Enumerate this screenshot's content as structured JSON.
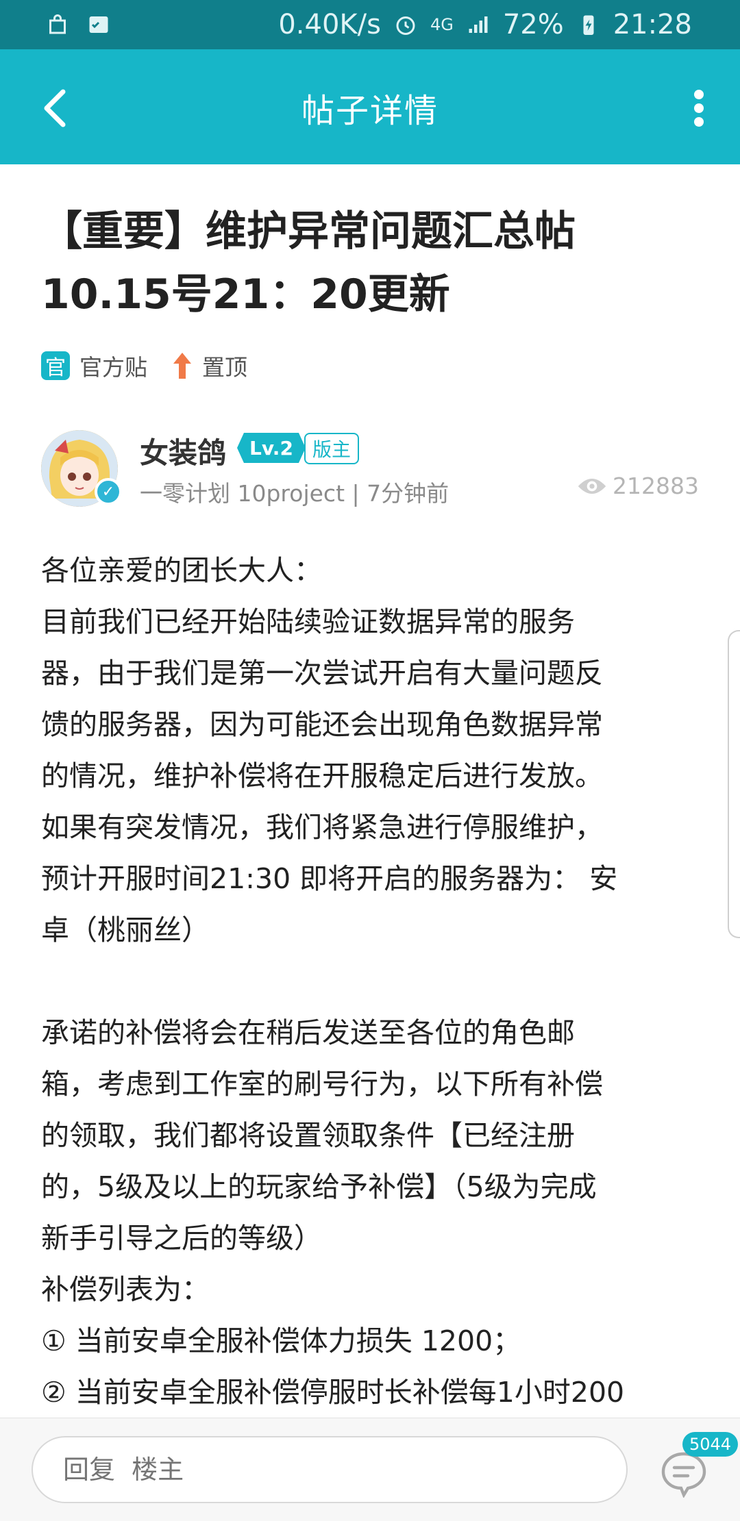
{
  "status_bar": {
    "speed": "0.40K/s",
    "network": "4G",
    "battery": "72%",
    "time": "21:28"
  },
  "header": {
    "title": "帖子详情",
    "back_icon": "back-arrow-icon",
    "more_icon": "more-vertical-icon"
  },
  "post": {
    "title_line1": "【重要】维护异常问题汇总帖",
    "title_line2": "10.15号21：20更新",
    "tags": [
      {
        "badge": "官",
        "label": "官方贴"
      },
      {
        "label": "置顶"
      }
    ]
  },
  "author": {
    "name": "女装鸽",
    "level": "Lv.2",
    "role": "版主",
    "meta": "一零计划 10project  |  7分钟前",
    "views": "212883"
  },
  "content": {
    "lines": [
      "各位亲爱的团长大人：",
      "目前我们已经开始陆续验证数据异常的服务",
      "器，由于我们是第一次尝试开启有大量问题反",
      "馈的服务器，因为可能还会出现角色数据异常",
      "的情况，维护补偿将在开服稳定后进行发放。",
      "如果有突发情况，我们将紧急进行停服维护，",
      "预计开服时间21:30 即将开启的服务器为： 安",
      "卓（桃丽丝）",
      "",
      "承诺的补偿将会在稍后发送至各位的角色邮",
      "箱，考虑到工作室的刷号行为，以下所有补偿",
      "的领取，我们都将设置领取条件【已经注册",
      "的，5级及以上的玩家给予补偿】（5级为完成",
      "新手引导之后的等级）",
      "补偿列表为：",
      "① 当前安卓全服补偿体力损失 1200；",
      "② 当前安卓全服补偿停服时长补偿每1小时200"
    ]
  },
  "reply_bar": {
    "placeholder": "回复  楼主",
    "comment_count": "5044"
  },
  "colors": {
    "accent": "#17b6c8",
    "status_bar": "#107f8b"
  }
}
